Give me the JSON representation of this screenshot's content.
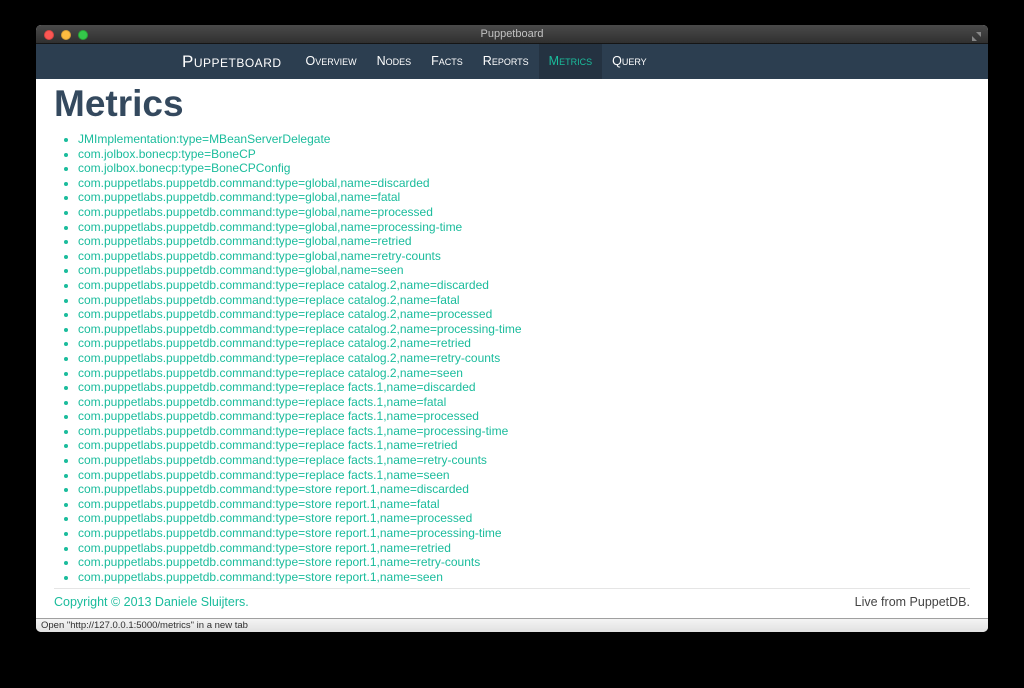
{
  "colors": {
    "accent": "#1abc9c",
    "navbar": "#2c3e50",
    "heading": "#34495e"
  },
  "window": {
    "title": "Puppetboard",
    "icons": {
      "fullscreen": "expand-arrows-icon",
      "close": "close-icon",
      "minimize": "minimize-icon",
      "zoom": "zoom-icon"
    }
  },
  "navbar": {
    "brand": "Puppetboard",
    "items": [
      {
        "label": "Overview",
        "active": false
      },
      {
        "label": "Nodes",
        "active": false
      },
      {
        "label": "Facts",
        "active": false
      },
      {
        "label": "Reports",
        "active": false
      },
      {
        "label": "Metrics",
        "active": true
      },
      {
        "label": "Query",
        "active": false
      }
    ]
  },
  "page": {
    "heading": "Metrics",
    "metrics": [
      "JMImplementation:type=MBeanServerDelegate",
      "com.jolbox.bonecp:type=BoneCP",
      "com.jolbox.bonecp:type=BoneCPConfig",
      "com.puppetlabs.puppetdb.command:type=global,name=discarded",
      "com.puppetlabs.puppetdb.command:type=global,name=fatal",
      "com.puppetlabs.puppetdb.command:type=global,name=processed",
      "com.puppetlabs.puppetdb.command:type=global,name=processing-time",
      "com.puppetlabs.puppetdb.command:type=global,name=retried",
      "com.puppetlabs.puppetdb.command:type=global,name=retry-counts",
      "com.puppetlabs.puppetdb.command:type=global,name=seen",
      "com.puppetlabs.puppetdb.command:type=replace catalog.2,name=discarded",
      "com.puppetlabs.puppetdb.command:type=replace catalog.2,name=fatal",
      "com.puppetlabs.puppetdb.command:type=replace catalog.2,name=processed",
      "com.puppetlabs.puppetdb.command:type=replace catalog.2,name=processing-time",
      "com.puppetlabs.puppetdb.command:type=replace catalog.2,name=retried",
      "com.puppetlabs.puppetdb.command:type=replace catalog.2,name=retry-counts",
      "com.puppetlabs.puppetdb.command:type=replace catalog.2,name=seen",
      "com.puppetlabs.puppetdb.command:type=replace facts.1,name=discarded",
      "com.puppetlabs.puppetdb.command:type=replace facts.1,name=fatal",
      "com.puppetlabs.puppetdb.command:type=replace facts.1,name=processed",
      "com.puppetlabs.puppetdb.command:type=replace facts.1,name=processing-time",
      "com.puppetlabs.puppetdb.command:type=replace facts.1,name=retried",
      "com.puppetlabs.puppetdb.command:type=replace facts.1,name=retry-counts",
      "com.puppetlabs.puppetdb.command:type=replace facts.1,name=seen",
      "com.puppetlabs.puppetdb.command:type=store report.1,name=discarded",
      "com.puppetlabs.puppetdb.command:type=store report.1,name=fatal",
      "com.puppetlabs.puppetdb.command:type=store report.1,name=processed",
      "com.puppetlabs.puppetdb.command:type=store report.1,name=processing-time",
      "com.puppetlabs.puppetdb.command:type=store report.1,name=retried",
      "com.puppetlabs.puppetdb.command:type=store report.1,name=retry-counts",
      "com.puppetlabs.puppetdb.command:type=store report.1,name=seen"
    ]
  },
  "footer": {
    "copyright": "Copyright © 2013 Daniele Sluijters.",
    "live": "Live from PuppetDB."
  },
  "statusbar": {
    "text": "Open \"http://127.0.0.1:5000/metrics\" in a new tab"
  }
}
